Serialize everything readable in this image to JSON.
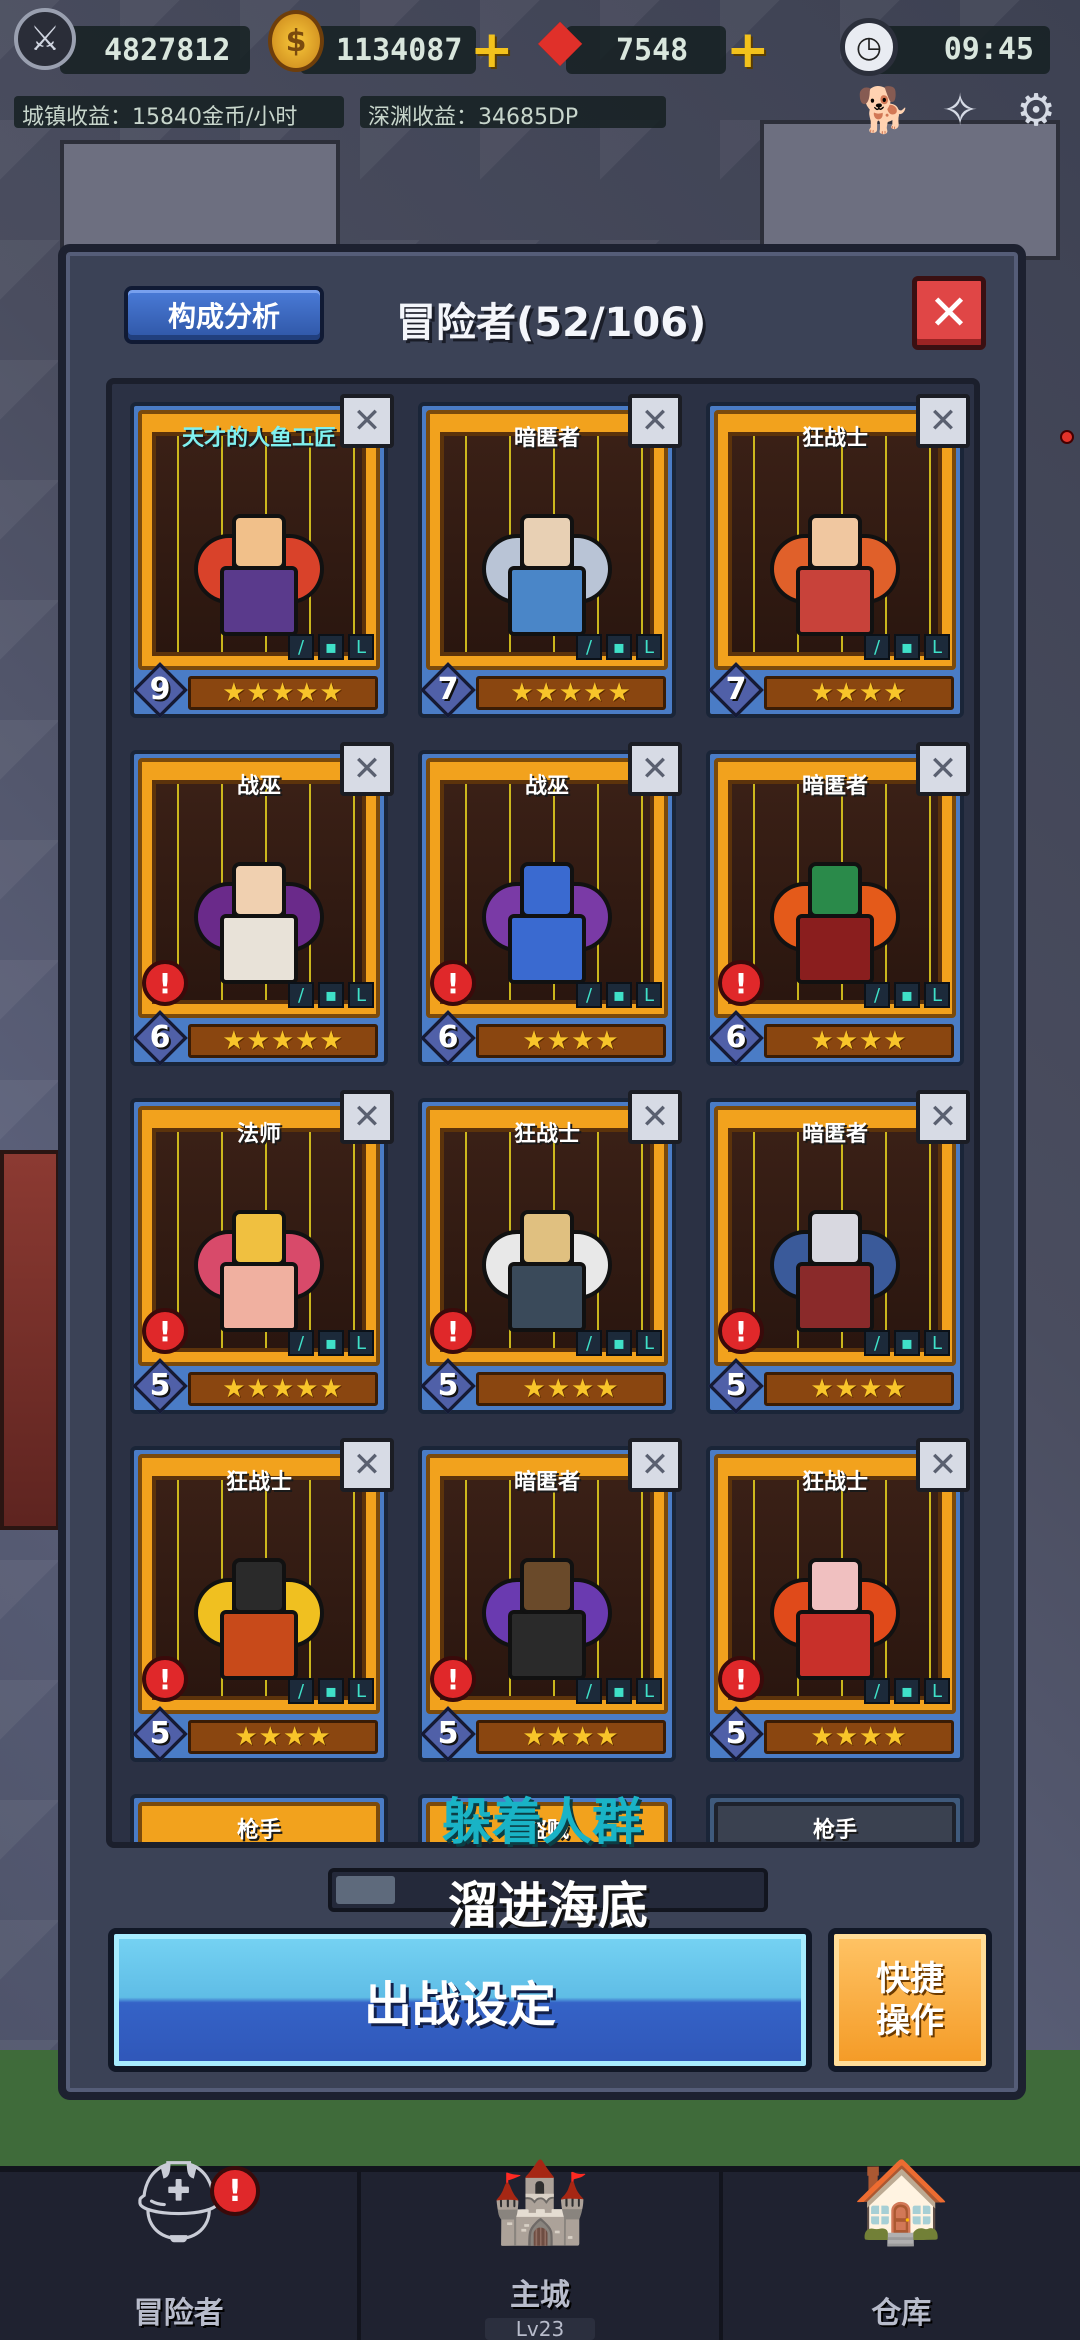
{
  "hud": {
    "power": "4827812",
    "gold": "1134087",
    "gems": "7548",
    "time": "09:45",
    "town_income": "城镇收益：15840金币/小时",
    "abyss_income": "深渊收益：34685DP"
  },
  "panel": {
    "analysis_label": "构成分析",
    "title": "冒险者(52/106)",
    "close_label": "✕"
  },
  "cards": [
    {
      "name": "天才的人鱼工匠",
      "level": "9",
      "stars": "★★★★★",
      "alert": false,
      "colors": {
        "head": "#f1c08a",
        "body": "#5a3a8c",
        "wing": "#d9422a"
      }
    },
    {
      "name": "暗匿者",
      "level": "7",
      "stars": "★★★★★",
      "alert": false,
      "colors": {
        "head": "#e8d0b4",
        "body": "#4a86c8",
        "wing": "#b9c4d6"
      }
    },
    {
      "name": "狂战士",
      "level": "7",
      "stars": "★★★★",
      "alert": false,
      "colors": {
        "head": "#f0c7a0",
        "body": "#c8423a",
        "wing": "#e0602a"
      }
    },
    {
      "name": "战巫",
      "level": "6",
      "stars": "★★★★★",
      "alert": true,
      "colors": {
        "head": "#f0d0b0",
        "body": "#e8e2d8",
        "wing": "#6a2a8a"
      }
    },
    {
      "name": "战巫",
      "level": "6",
      "stars": "★★★★",
      "alert": true,
      "colors": {
        "head": "#3a6ad0",
        "body": "#3a6ad0",
        "wing": "#7a3aa6"
      }
    },
    {
      "name": "暗匿者",
      "level": "6",
      "stars": "★★★★",
      "alert": true,
      "colors": {
        "head": "#2a8a4a",
        "body": "#8a1e1e",
        "wing": "#e45a1a"
      }
    },
    {
      "name": "法师",
      "level": "5",
      "stars": "★★★★★",
      "alert": true,
      "colors": {
        "head": "#f0c040",
        "body": "#f0b0a0",
        "wing": "#d84a6a"
      }
    },
    {
      "name": "狂战士",
      "level": "5",
      "stars": "★★★★",
      "alert": true,
      "colors": {
        "head": "#e0c080",
        "body": "#3a4a5a",
        "wing": "#e8e8e8"
      }
    },
    {
      "name": "暗匿者",
      "level": "5",
      "stars": "★★★★",
      "alert": true,
      "colors": {
        "head": "#d8d8e0",
        "body": "#8a2a2a",
        "wing": "#3a5a9a"
      }
    },
    {
      "name": "狂战士",
      "level": "5",
      "stars": "★★★★",
      "alert": true,
      "colors": {
        "head": "#2a2a2a",
        "body": "#c84a1a",
        "wing": "#f0c020"
      }
    },
    {
      "name": "暗匿者",
      "level": "5",
      "stars": "★★★★",
      "alert": true,
      "colors": {
        "head": "#6a4a2a",
        "body": "#2a2a2a",
        "wing": "#6a3ab0"
      }
    },
    {
      "name": "狂战士",
      "level": "5",
      "stars": "★★★★",
      "alert": true,
      "colors": {
        "head": "#f0c0c0",
        "body": "#c8302a",
        "wing": "#e04a1a"
      }
    }
  ],
  "partial_cards": [
    "枪手",
    "盗贼",
    "枪手"
  ],
  "overlay_text": "躲着人群",
  "progress": {
    "label": "溜进海底",
    "fraction": 0.08
  },
  "deploy_label": "出战设定",
  "quick_label_1": "快捷",
  "quick_label_2": "操作",
  "nav": {
    "adventurer": "冒险者",
    "main_city": "主城",
    "main_city_level": "Lv23",
    "warehouse": "仓库"
  }
}
